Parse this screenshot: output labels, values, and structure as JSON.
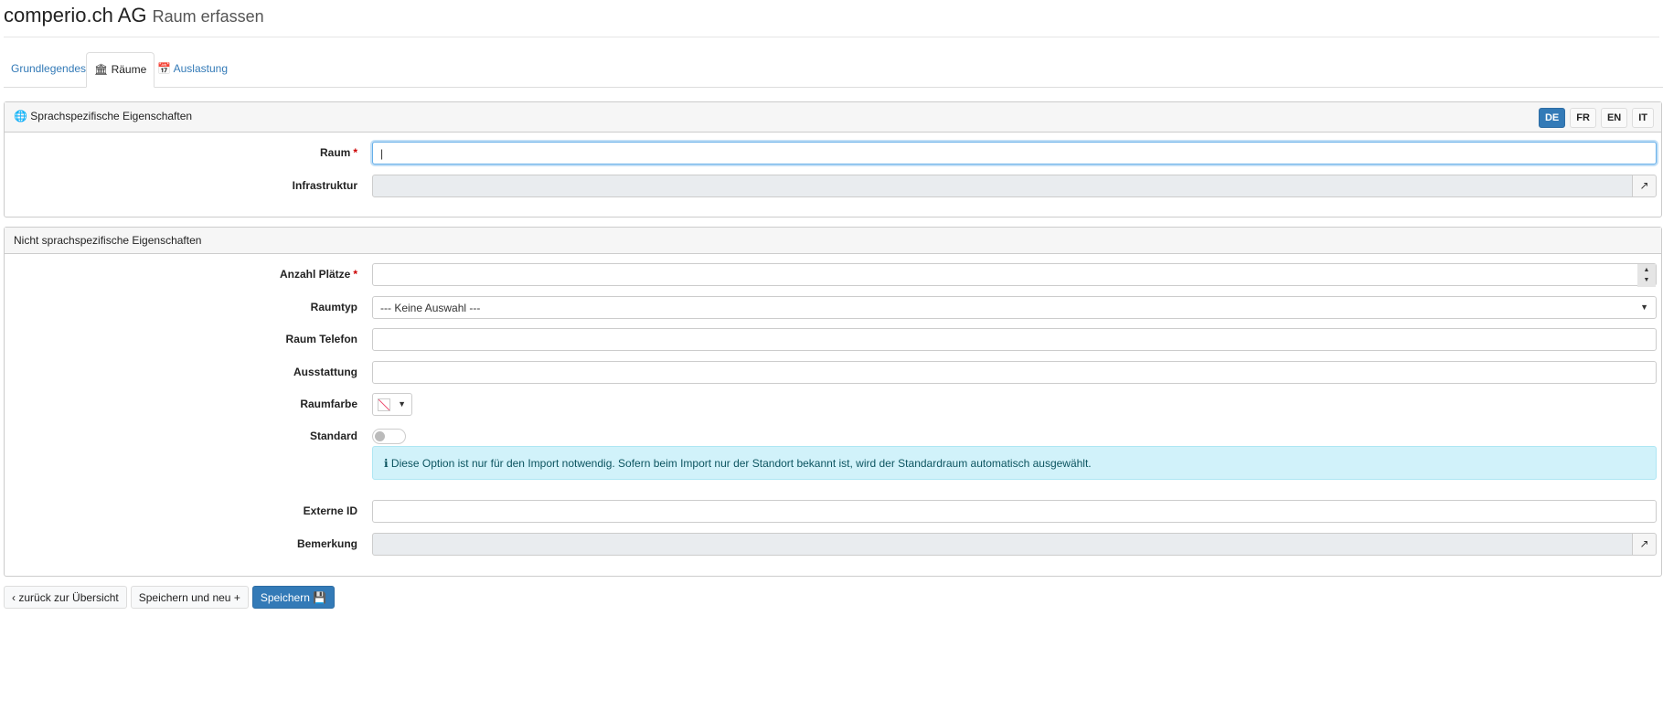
{
  "header": {
    "company": "comperio.ch AG",
    "page_title": "Raum erfassen"
  },
  "tabs": [
    {
      "label": "Grundlegendes",
      "icon": "none"
    },
    {
      "label": "Räume",
      "icon": "bank-icon",
      "active": true
    },
    {
      "label": "Auslastung",
      "icon": "calendar-icon"
    }
  ],
  "panel_lang": {
    "title": "Sprachspezifische Eigenschaften",
    "icon": "globe-icon",
    "languages": [
      "DE",
      "FR",
      "EN",
      "IT"
    ],
    "active_language": "DE",
    "fields": {
      "raum": {
        "label": "Raum",
        "value": "|"
      },
      "infrastruktur": {
        "label": "Infrastruktur",
        "value": ""
      }
    }
  },
  "panel_general": {
    "title": "Nicht sprachspezifische Eigenschaften",
    "fields": {
      "anzahl": {
        "label": "Anzahl Plätze",
        "value": ""
      },
      "raumtyp": {
        "label": "Raumtyp",
        "value": "--- Keine Auswahl ---"
      },
      "telefon": {
        "label": "Raum Telefon",
        "value": ""
      },
      "ausstattung": {
        "label": "Ausstattung",
        "value": ""
      },
      "raumfarbe": {
        "label": "Raumfarbe"
      },
      "standard": {
        "label": "Standard",
        "checked": false
      },
      "externe_id": {
        "label": "Externe ID",
        "value": ""
      },
      "bemerkung": {
        "label": "Bemerkung",
        "value": ""
      }
    },
    "info": "Diese Option ist nur für den Import notwendig. Sofern beim Import nur der Standort bekannt ist, wird der Standardraum automatisch ausgewählt."
  },
  "required_marker": "*",
  "buttons": {
    "back": "zurück zur Übersicht",
    "save_new": "Speichern und neu",
    "save": "Speichern"
  },
  "colors": {
    "primary": "#337ab7",
    "info_bg": "#d1f2fa"
  }
}
